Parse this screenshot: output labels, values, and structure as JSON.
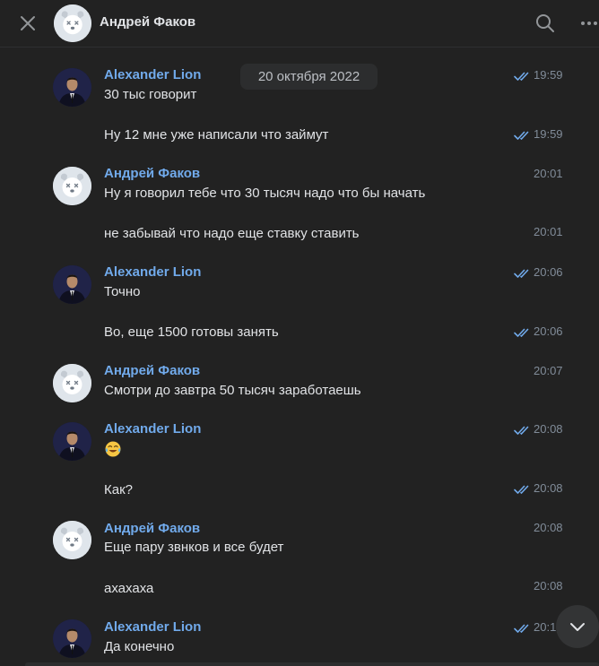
{
  "header": {
    "title": "Андрей Факов",
    "close_icon": "close-icon",
    "search_icon": "search-icon",
    "more_icon": "more-horizontal-icon"
  },
  "date_separator": "20 октября 2022",
  "messages": [
    {
      "author": "Alexander Lion",
      "text": "30 тыс говорит",
      "time": "19:59",
      "read": true
    },
    {
      "text": "Ну 12 мне уже написали что займут",
      "time": "19:59",
      "read": true
    },
    {
      "author": "Андрей Факов",
      "text": "Ну я говорил тебе что 30 тысяч надо что бы начать",
      "time": "20:01"
    },
    {
      "text": "не забывай что надо еще ставку ставить",
      "time": "20:01"
    },
    {
      "author": "Alexander Lion",
      "text": "Точно",
      "time": "20:06",
      "read": true
    },
    {
      "text": "Во, еще 1500 готовы занять",
      "time": "20:06",
      "read": true
    },
    {
      "author": "Андрей Факов",
      "text": "Смотри до завтра 50 тысяч заработаешь",
      "time": "20:07"
    },
    {
      "author": "Alexander Lion",
      "emoji": "tears-of-joy-emoji",
      "time": "20:08",
      "read": true
    },
    {
      "text": "Как?",
      "time": "20:08",
      "read": true
    },
    {
      "author": "Андрей Факов",
      "text": "Еще пару звнков и все будет",
      "time": "20:08"
    },
    {
      "text": "ахахаха",
      "time": "20:08"
    },
    {
      "author": "Alexander Lion",
      "text": "Да конечно",
      "time": "20:1",
      "read": true
    }
  ],
  "colors": {
    "background": "#222222",
    "author_name": "#71aaeb",
    "text": "#e1e3e6",
    "time": "#818c99",
    "read_check": "#71aaeb"
  }
}
